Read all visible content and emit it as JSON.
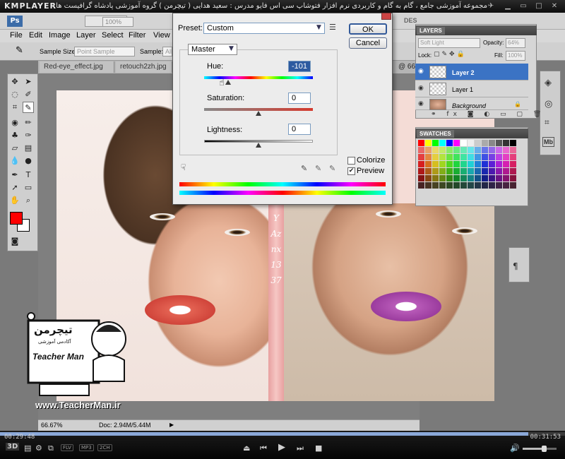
{
  "player": {
    "logo": "KMPLAYER",
    "caption": "مجموعه آموزشی جامع ، گام به گام و کاربردی نرم افزار فتوشاپ سی اس فایو   مدرس : سعید هدایی ( تیچرمن ) گروه آموزشی پادشاه گرافیست ها",
    "time_elapsed": "00:29:48",
    "time_total": "00:31:53",
    "badges": [
      "FLV",
      "MP3",
      "2CH"
    ],
    "seek_fraction": 0.935
  },
  "photoshop": {
    "logo": "Ps",
    "menu": [
      "File",
      "Edit",
      "Image",
      "Layer",
      "Select",
      "Filter",
      "View"
    ],
    "zoom_box": "100%",
    "options": {
      "sample_size_label": "Sample Size:",
      "sample_size_value": "Point Sample",
      "sample_label": "Sample:",
      "sample_value": "All"
    },
    "tabs": [
      "Red-eye_effect.jpg",
      "retouch2zh.jpg"
    ],
    "tab_right_zoom": "@ 66",
    "doc_tab_right": "DES",
    "status": {
      "zoom": "66.67%",
      "doc": "Doc: 2.94M/5.44M"
    },
    "strip_text": "Y Aznx1337"
  },
  "dialog": {
    "preset_label": "Preset:",
    "preset_value": "Custom",
    "ok": "OK",
    "cancel": "Cancel",
    "channel": "Master",
    "hue_label": "Hue:",
    "hue_value": "-101",
    "hue_fraction": 0.22,
    "saturation_label": "Saturation:",
    "saturation_value": "0",
    "saturation_fraction": 0.5,
    "lightness_label": "Lightness:",
    "lightness_value": "0",
    "lightness_fraction": 0.5,
    "colorize_label": "Colorize",
    "colorize_checked": false,
    "preview_label": "Preview",
    "preview_checked": true
  },
  "layers": {
    "tab": "LAYERS",
    "blend_mode": "Soft Light",
    "opacity_label": "Opacity:",
    "opacity_value": "64%",
    "lock_label": "Lock:",
    "fill_label": "Fill:",
    "fill_value": "100%",
    "items": [
      {
        "name": "Layer 2",
        "active": true
      },
      {
        "name": "Layer 1",
        "active": false
      },
      {
        "name": "Background",
        "active": false
      }
    ]
  },
  "swatches": {
    "tab": "SWATCHES"
  },
  "watermark": {
    "title_fa": "تیچرمن",
    "subtitle_fa": "آکادمی آموزشی",
    "title_en": "Teacher Man",
    "url": "www.TeacherMan.ir"
  },
  "colors": {
    "foreground": "#ff0000",
    "background": "#ffffff",
    "layer_active": "#3b73c4"
  }
}
